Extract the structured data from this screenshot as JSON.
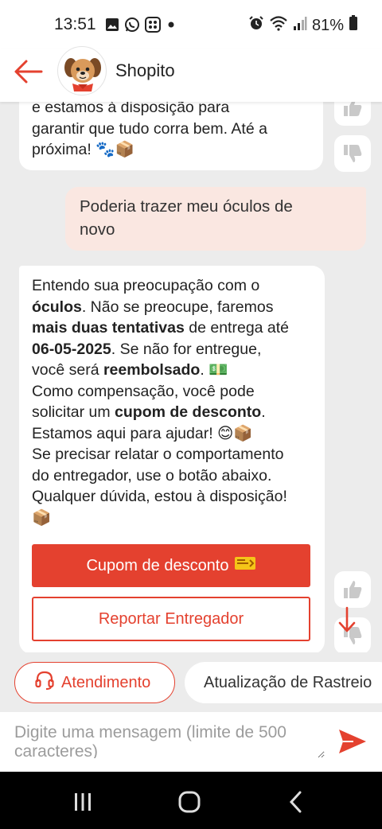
{
  "status_bar": {
    "time": "13:51",
    "battery": "81%"
  },
  "header": {
    "title": "Shopito",
    "back_icon": "back-arrow-icon",
    "avatar_icon": "dog-mascot-avatar"
  },
  "messages": {
    "bot_1_text": "e estamos à disposição para\ngarantir que tudo corra bem. Até a\npróxima! 🐾📦",
    "user_1_text": "Poderia trazer meu óculos de\nnovo",
    "bot_2": {
      "p1a": "Entendo sua preocupação com o",
      "p1b_bold": "óculos",
      "p1c": ". Não se preocupe, faremos",
      "p2_bold": "mais duas tentativas",
      "p2b": " de entrega até",
      "p3_bold": "06-05-2025",
      "p3b": ". Se não for entregue,",
      "p4a": "você será ",
      "p4_bold": "reembolsado",
      "p4c": ". 💵",
      "p5": "Como compensação, você pode",
      "p6a": "solicitar um ",
      "p6_bold": "cupom de desconto",
      "p6c": ".",
      "p7": "Estamos aqui para ajudar! 😊📦",
      "p8": "Se precisar relatar o comportamento",
      "p9": "do entregador, use o botão abaixo.",
      "p10": "Qualquer dúvida, estou à disposição!",
      "p11": "📦"
    },
    "coupon_button": "Cupom de desconto",
    "report_button": "Reportar Entregador"
  },
  "quick_replies": {
    "attend": "Atendimento",
    "tracking": "Atualização de Rastreio"
  },
  "input": {
    "placeholder": "Digite uma mensagem (limite de 500 caracteres)"
  },
  "colors": {
    "accent": "#e4412f",
    "user_bubble": "#fae7e1",
    "background": "#ececec"
  }
}
